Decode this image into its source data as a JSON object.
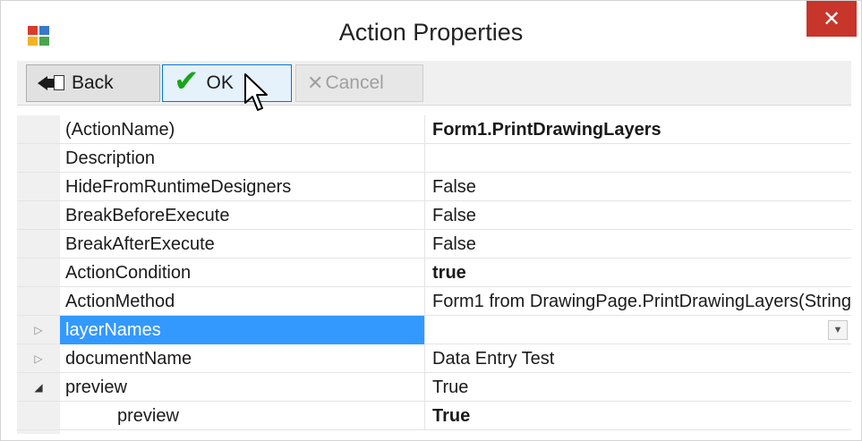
{
  "window": {
    "title": "Action Properties",
    "close_glyph": "✕"
  },
  "toolbar": {
    "back_label": "Back",
    "ok_label": "OK",
    "cancel_label": "Cancel"
  },
  "properties": [
    {
      "name": "(ActionName)",
      "value": "Form1.PrintDrawingLayers",
      "bold": true
    },
    {
      "name": "Description",
      "value": ""
    },
    {
      "name": "HideFromRuntimeDesigners",
      "value": "False"
    },
    {
      "name": "BreakBeforeExecute",
      "value": "False"
    },
    {
      "name": "BreakAfterExecute",
      "value": "False"
    },
    {
      "name": "ActionCondition",
      "value": "true",
      "bold": true
    },
    {
      "name": "ActionMethod",
      "value": "Form1 from DrawingPage.PrintDrawingLayers(String"
    },
    {
      "name": "layerNames",
      "value": "",
      "selected": true,
      "expander": "collapsed",
      "has_dropdown": true
    },
    {
      "name": "documentName",
      "value": "Data Entry Test",
      "expander": "collapsed"
    },
    {
      "name": "preview",
      "value": "True",
      "expander": "expanded"
    },
    {
      "name": "preview",
      "value": "True",
      "bold": true,
      "child": true
    }
  ],
  "colors": {
    "close_bg": "#c7352b",
    "selection": "#3399ff",
    "ok_check": "#1aa51a"
  },
  "icons": {
    "app": "app-icon",
    "back": "back-arrow-icon",
    "ok": "checkmark-icon",
    "cancel": "x-icon",
    "expand_collapsed": "triangle-right-icon",
    "expand_expanded": "triangle-down-icon",
    "dropdown": "chevron-down-icon"
  }
}
